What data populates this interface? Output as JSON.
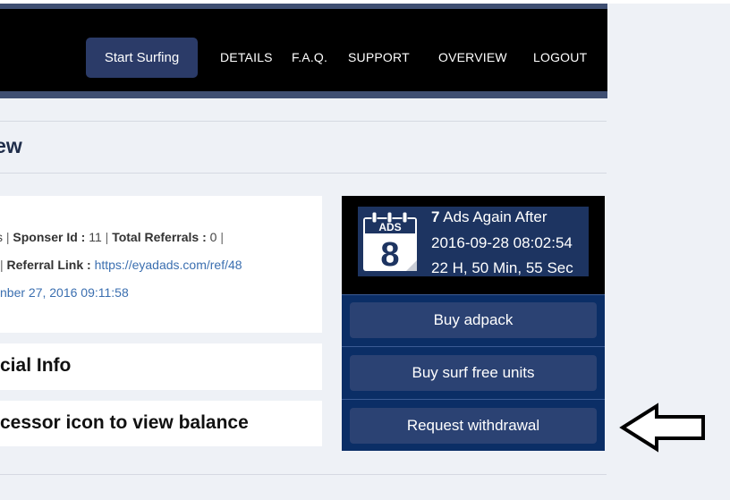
{
  "nav": {
    "start_surfing": "Start Surfing",
    "links": [
      "DETAILS",
      "F.A.Q.",
      "SUPPORT",
      "OVERVIEW",
      "LOGOUT"
    ]
  },
  "page": {
    "title": "rview"
  },
  "account": {
    "line1": {
      "lead": "s",
      "sponsor_label": "Sponser Id :",
      "sponsor_value": "11",
      "referrals_label": "Total Referrals :",
      "referrals_value": "0"
    },
    "line2": {
      "referral_label": "Referral Link :",
      "referral_link": "https://eyadads.com/ref/48"
    },
    "line3": {
      "date": "nber 27, 2016 09:11:58"
    }
  },
  "sections": {
    "financial": "cial Info",
    "processor": "cessor icon to view balance"
  },
  "ads": {
    "icon_label": "ADS",
    "icon_number": "8",
    "count": "7",
    "line1_suffix": "Ads Again After",
    "line2": "2016-09-28 08:02:54",
    "line3": "22 H, 50 Min, 55 Sec"
  },
  "buttons": {
    "buy_adpack": "Buy adpack",
    "buy_surf": "Buy surf free units",
    "request_withdrawal": "Request withdrawal"
  },
  "colors": {
    "navbar": "#000000",
    "nav_button": "#2b3b68",
    "panel": "#0b2e66",
    "panel_button": "#2b4273",
    "link": "#3b6fb0"
  }
}
